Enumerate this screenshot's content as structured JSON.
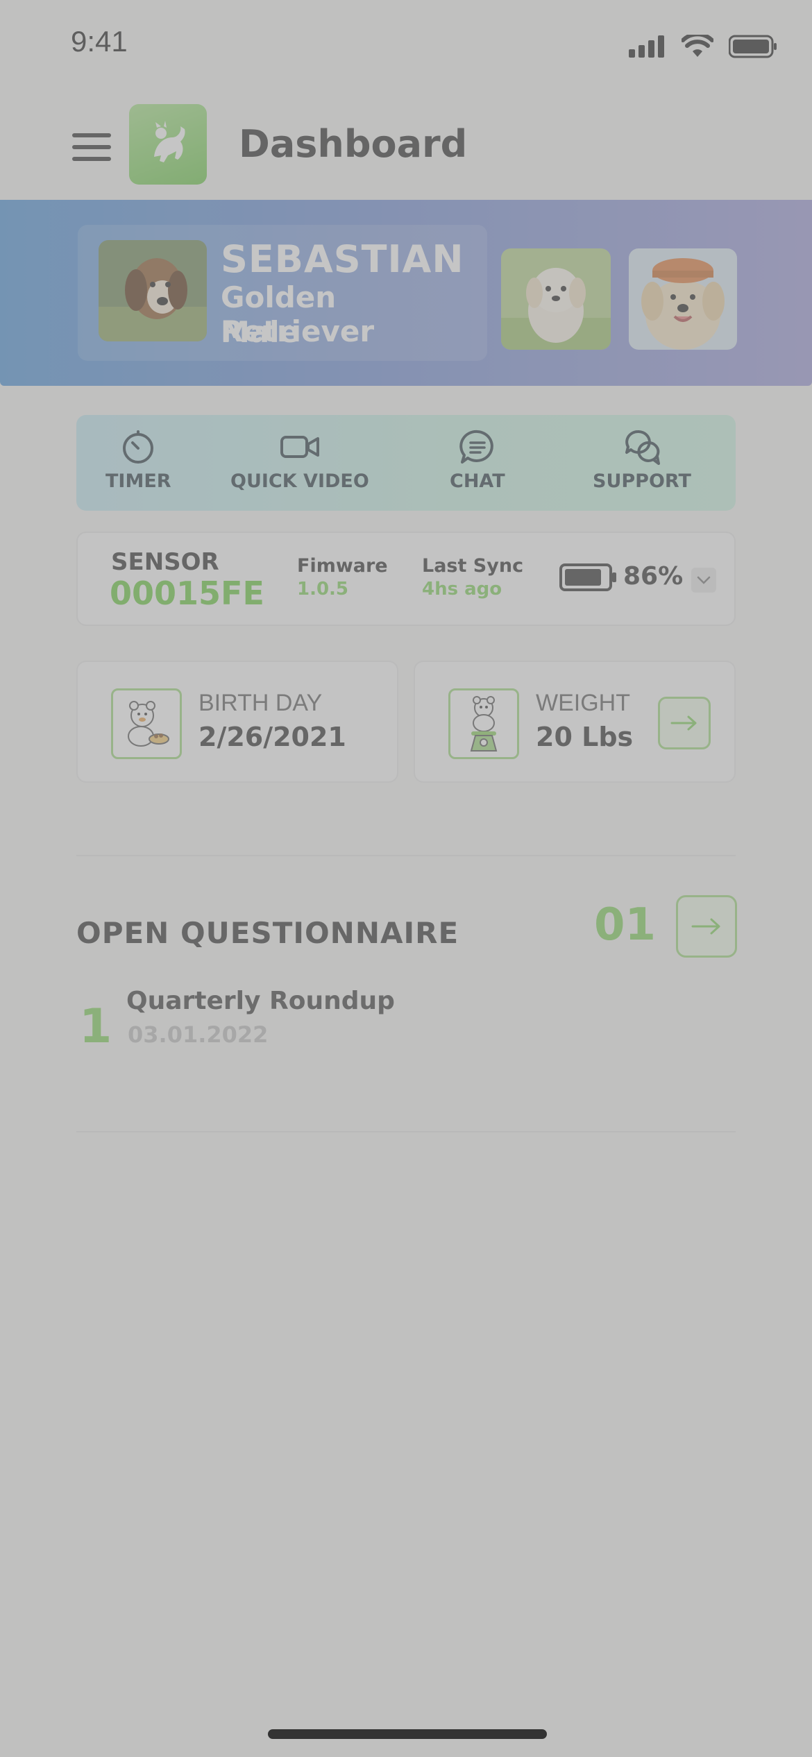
{
  "status_bar": {
    "time": "9:41"
  },
  "header": {
    "title": "Dashboard"
  },
  "pets": {
    "active": {
      "name": "SEBASTIAN",
      "breed": "Golden Retriever",
      "sex": "Male"
    }
  },
  "actions": [
    {
      "label": "TIMER",
      "icon": "timer-icon"
    },
    {
      "label": "QUICK VIDEO",
      "icon": "video-camera-icon"
    },
    {
      "label": "CHAT",
      "icon": "chat-bubble-icon"
    },
    {
      "label": "SUPPORT",
      "icon": "support-chat-icon"
    }
  ],
  "sensor": {
    "label": "SENSOR",
    "id": "00015FE",
    "firmware_label": "Fimware",
    "firmware_value": "1.0.5",
    "sync_label": "Last Sync",
    "sync_value": "4hs ago",
    "battery_percent_text": "86%",
    "battery_level": 0.86
  },
  "stats": {
    "birthday": {
      "label": "BIRTH DAY",
      "value": "2/26/2021"
    },
    "weight": {
      "label": "WEIGHT",
      "value": "20 Lbs"
    }
  },
  "questionnaire": {
    "title": "OPEN QUESTIONNAIRE",
    "count": "01",
    "items": [
      {
        "number": "1",
        "title": "Quarterly Roundup",
        "date": "03.01.2022"
      }
    ]
  },
  "colors": {
    "accent_green": "#7ed15a",
    "pet_band_start": "#4d92d8",
    "pet_band_end": "#9c9ad8",
    "overlay": "rgba(150,150,150,0.55)"
  }
}
